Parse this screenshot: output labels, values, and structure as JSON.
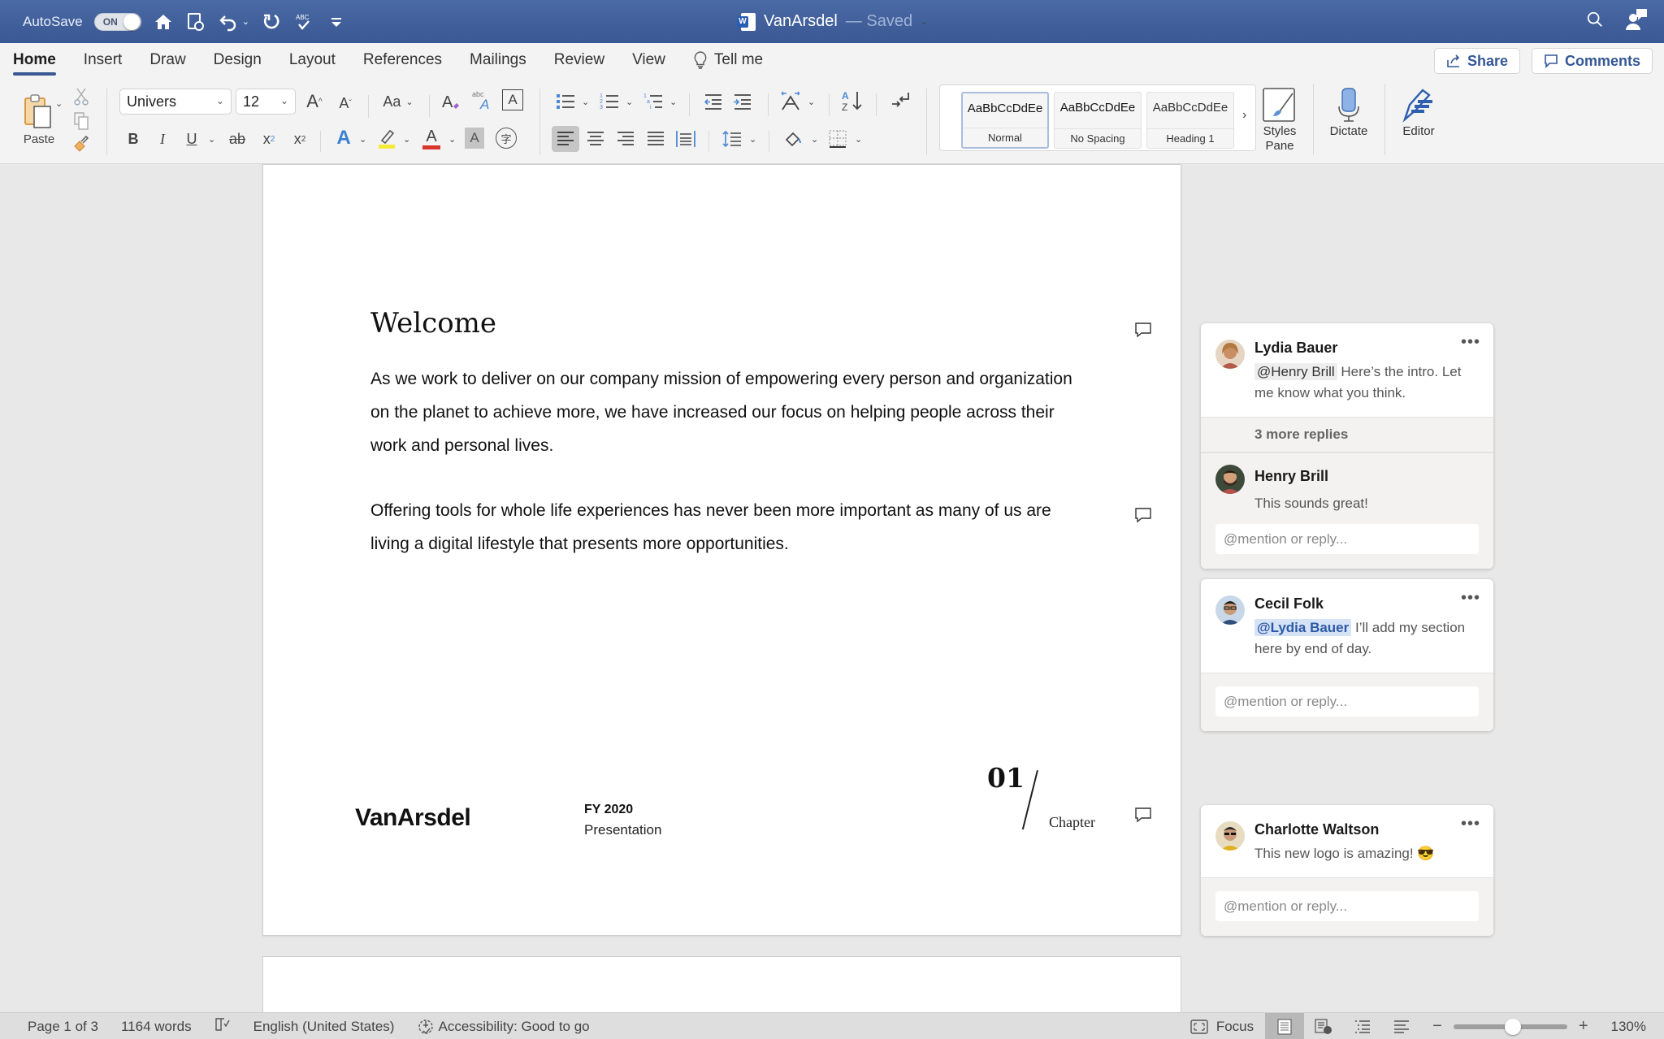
{
  "titlebar": {
    "autosave_label": "AutoSave",
    "autosave_state": "ON",
    "doc_title": "VanArsdel",
    "save_status": "— Saved",
    "quick_access_icons": [
      "home-icon",
      "sync-save-icon",
      "undo-icon",
      "redo-icon",
      "spelling-check-icon",
      "customize-toolbar-icon"
    ]
  },
  "tabs": [
    {
      "label": "Home",
      "active": true
    },
    {
      "label": "Insert"
    },
    {
      "label": "Draw"
    },
    {
      "label": "Design"
    },
    {
      "label": "Layout"
    },
    {
      "label": "References"
    },
    {
      "label": "Mailings"
    },
    {
      "label": "Review"
    },
    {
      "label": "View"
    }
  ],
  "tell_me": "Tell me",
  "share_label": "Share",
  "comments_label": "Comments",
  "ribbon": {
    "paste_label": "Paste",
    "font_name": "Univers",
    "font_size": "12",
    "bold": "B",
    "italic": "I",
    "underline": "U",
    "strike": "ab",
    "change_case": "Aa",
    "styles": [
      {
        "sample": "AaBbCcDdEe",
        "name": "Normal",
        "selected": true
      },
      {
        "sample": "AaBbCcDdEe",
        "name": "No Spacing"
      },
      {
        "sample": "AaBbCcDdEe",
        "name": "Heading 1"
      }
    ],
    "styles_pane_label": "Styles Pane",
    "dictate_label": "Dictate",
    "editor_label": "Editor"
  },
  "document": {
    "heading": "Welcome",
    "paragraphs": [
      "As we work to deliver on our company mission of empowering every person and organization on the planet to achieve more, we have increased our focus on helping people across their work and personal lives.",
      "Offering tools for whole life experiences has never been more important as many of us are living a digital lifestyle that presents more opportunities."
    ],
    "footer": {
      "logo": "VanArsdel",
      "fy": "FY 2020",
      "subtitle": "Presentation",
      "chapter_number": "01",
      "chapter_label": "Chapter"
    }
  },
  "comments": [
    {
      "author": "Lydia Bauer",
      "mention": "@Henry Brill",
      "text": "Here’s the intro. Let me know what you think.",
      "more_replies": "3 more replies",
      "reply": {
        "author": "Henry Brill",
        "text": "This sounds great!"
      },
      "reply_placeholder": "@mention or reply..."
    },
    {
      "author": "Cecil Folk",
      "mention": "@Lydia Bauer",
      "text": "I’ll add my section here by end of day.",
      "reply_placeholder": "@mention or reply..."
    },
    {
      "author": "Charlotte Waltson",
      "text": "This new logo is amazing! 😎",
      "reply_placeholder": "@mention or reply..."
    }
  ],
  "statusbar": {
    "page": "Page 1 of 3",
    "words": "1164 words",
    "language": "English (United States)",
    "accessibility": "Accessibility: Good to go",
    "focus": "Focus",
    "zoom_level": "130%",
    "zoom_fraction": 0.52
  }
}
